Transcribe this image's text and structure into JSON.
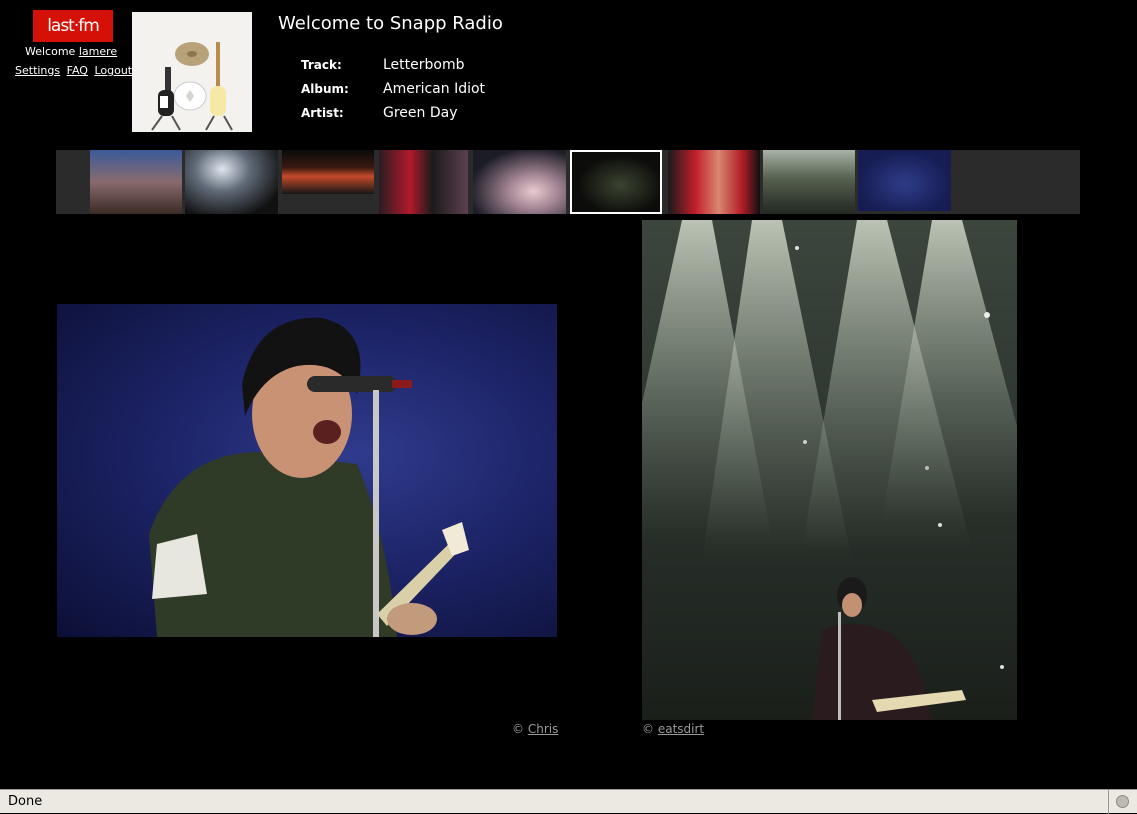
{
  "header": {
    "logo_text": "last·fm",
    "welcome_text": "Welcome",
    "username": "lamere",
    "links": [
      "Settings",
      "FAQ",
      "Logout"
    ],
    "title": "Welcome to Snapp Radio"
  },
  "now_playing": {
    "track_label": "Track:",
    "track": "Letterbomb",
    "album_label": "Album:",
    "album": "American Idiot",
    "artist_label": "Artist:",
    "artist": "Green Day"
  },
  "thumbnails": {
    "count": 9,
    "selected_index": 5
  },
  "photos": {
    "left_credit_symbol": "©",
    "left_credit": "Chris",
    "right_credit_symbol": "©",
    "right_credit": "eatsdirt"
  },
  "statusbar": {
    "text": "Done"
  },
  "colors": {
    "brand": "#d51007",
    "background": "#000000",
    "strip_bg": "#2b2b2b"
  }
}
